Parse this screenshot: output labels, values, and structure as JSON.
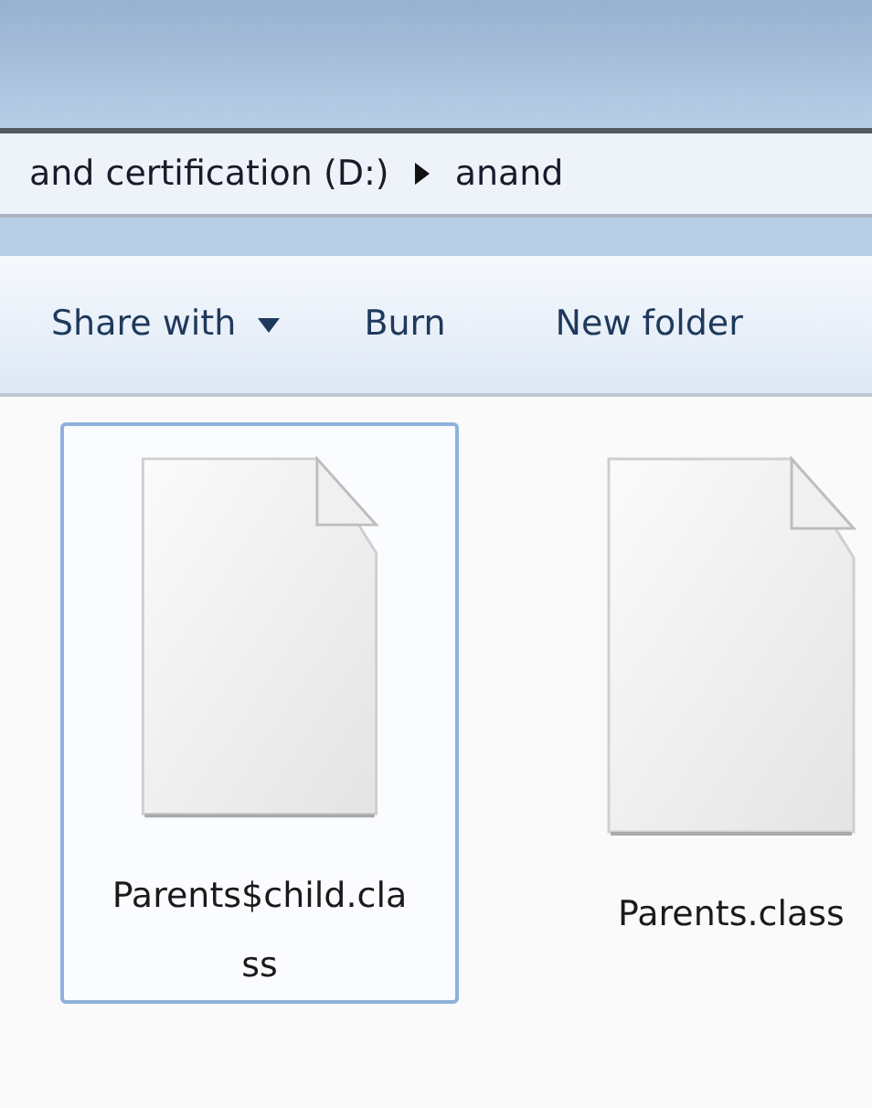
{
  "address_bar": {
    "segments": [
      "and certification (D:)",
      "anand"
    ]
  },
  "toolbar": [
    {
      "label": "Share with",
      "kind": "dropdown"
    },
    {
      "label": "Burn",
      "kind": "button"
    },
    {
      "label": "New folder",
      "kind": "button"
    }
  ],
  "files": [
    {
      "name": "Parents$child.class",
      "selected": true
    },
    {
      "name": "Parents.class",
      "selected": false
    }
  ]
}
